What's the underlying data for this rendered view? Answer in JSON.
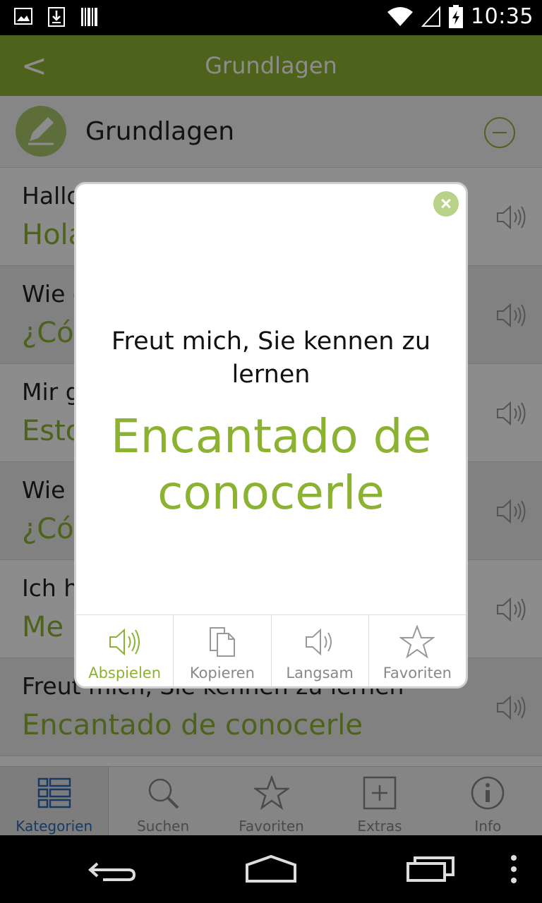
{
  "status_bar": {
    "time": "10:35",
    "left_icons": [
      "image-icon",
      "download-icon",
      "barcode-icon"
    ],
    "right_icons": [
      "wifi-icon",
      "signal-icon",
      "battery-charging-icon"
    ]
  },
  "action_bar": {
    "back_label": "<",
    "title": "Grundlagen"
  },
  "category": {
    "title": "Grundlagen",
    "icon": "pencil-icon"
  },
  "phrases": [
    {
      "de": "Hallo",
      "es": "Hola"
    },
    {
      "de": "Wie geht's?",
      "es": "¿Cómo estás?"
    },
    {
      "de": "Mir geht es gut",
      "es": "Estoy bien"
    },
    {
      "de": "Wie ist Ihr Name?",
      "es": "¿Cómo te llamas?"
    },
    {
      "de": "Ich heiße",
      "es": "Me llamo"
    },
    {
      "de": "Freut mich, Sie kennen zu lernen",
      "es": "Encantado de conocerle"
    }
  ],
  "tabs": [
    {
      "label": "Kategorien",
      "icon": "list-icon",
      "active": true
    },
    {
      "label": "Suchen",
      "icon": "search-icon",
      "active": false
    },
    {
      "label": "Favoriten",
      "icon": "star-icon",
      "active": false
    },
    {
      "label": "Extras",
      "icon": "plus-square-icon",
      "active": false
    },
    {
      "label": "Info",
      "icon": "info-icon",
      "active": false
    }
  ],
  "dialog": {
    "german": "Freut mich, Sie kennen zu lernen",
    "spanish": "Encantado de conocerle",
    "actions": [
      {
        "label": "Abspielen",
        "icon": "speaker-icon"
      },
      {
        "label": "Kopieren",
        "icon": "copy-icon"
      },
      {
        "label": "Langsam",
        "icon": "speaker-slow-icon"
      },
      {
        "label": "Favoriten",
        "icon": "star-icon"
      }
    ]
  },
  "colors": {
    "accent": "#8cb232",
    "tab_active": "#2a6ab8"
  }
}
